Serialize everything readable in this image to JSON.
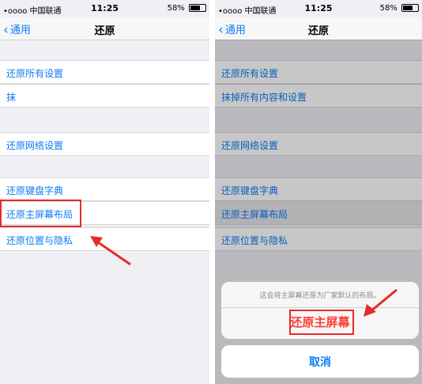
{
  "colors": {
    "accent": "#0b7cf7",
    "destructive": "#ff3b30",
    "highlight_box": "#e52b2b"
  },
  "status_bar": {
    "carrier": "•oooo 中国联通",
    "wifi_icon": "wifi-icon",
    "time": "11:25",
    "battery": "58%",
    "battery_level": 0.58
  },
  "nav": {
    "back_label": "通用",
    "title": "还原"
  },
  "left_panel": {
    "items": [
      {
        "label": "还原所有设置"
      },
      {
        "label": "抹"
      },
      {
        "label": "还原网络设置"
      },
      {
        "label": "还原键盘字典"
      },
      {
        "label": "还原主屏幕布局"
      },
      {
        "label": "还原位置与隐私"
      }
    ]
  },
  "right_panel": {
    "items": [
      {
        "label": "还原所有设置"
      },
      {
        "label": "抹掉所有内容和设置"
      },
      {
        "label": "还原网络设置"
      },
      {
        "label": "还原键盘字典"
      },
      {
        "label": "还原主屏幕布局"
      },
      {
        "label": "还原位置与隐私"
      }
    ],
    "action_sheet": {
      "message": "这会将主屏幕还原为厂家默认的布局。",
      "destructive_label": "还原主屏幕",
      "cancel_label": "取消"
    }
  }
}
